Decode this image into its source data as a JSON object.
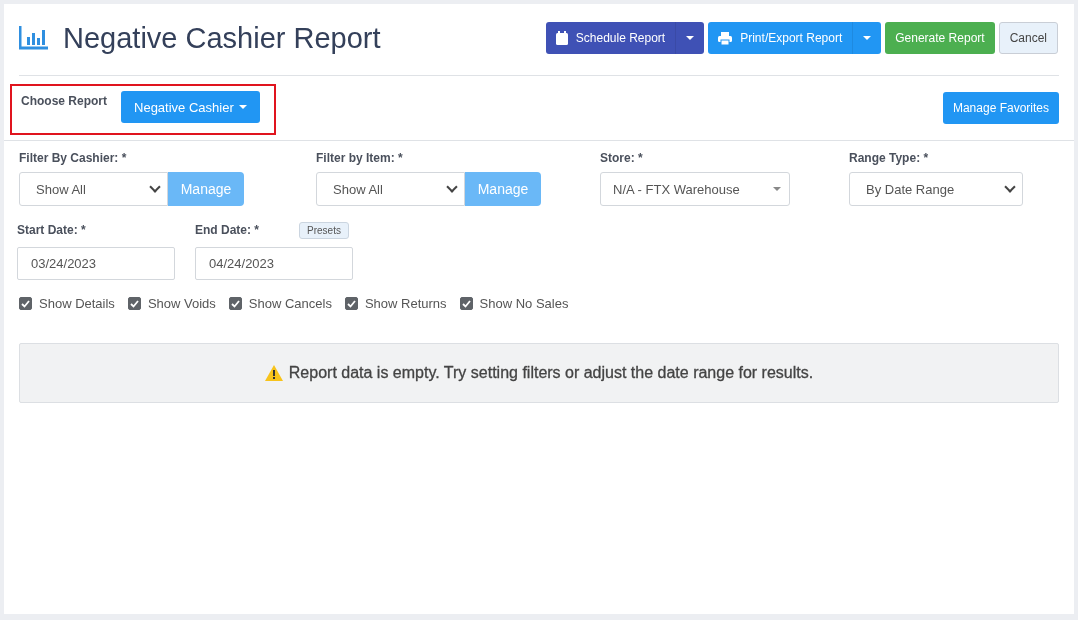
{
  "header": {
    "title": "Negative Cashier Report",
    "actions": [
      {
        "label": "Schedule Report",
        "kind": "schedule"
      },
      {
        "label": "Print/Export Report",
        "kind": "export"
      },
      {
        "label": "Generate Report",
        "kind": "generate"
      },
      {
        "label": "Cancel",
        "kind": "cancel"
      }
    ]
  },
  "choose_report": {
    "label": "Choose Report",
    "value": "Negative Cashier",
    "highlighted": true
  },
  "manage_favorites": "Manage Favorites",
  "filters": [
    {
      "label": "Filter By Cashier: *",
      "kind": "select-manage",
      "value": "Show All",
      "button": "Manage"
    },
    {
      "label": "Filter by Item: *",
      "kind": "select-manage",
      "value": "Show All",
      "button": "Manage"
    },
    {
      "label": "Store: *",
      "kind": "combo",
      "value": "N/A - FTX Warehouse"
    },
    {
      "label": "Range Type: *",
      "kind": "select",
      "value": "By Date Range"
    }
  ],
  "dates": [
    {
      "label": "Start Date: *",
      "value": "03/24/2023"
    },
    {
      "label": "End Date: *",
      "value": "04/24/2023",
      "presets": "Presets"
    }
  ],
  "options": [
    {
      "label": "Show Details",
      "checked": true
    },
    {
      "label": "Show Voids",
      "checked": true
    },
    {
      "label": "Show Cancels",
      "checked": true
    },
    {
      "label": "Show Returns",
      "checked": true
    },
    {
      "label": "Show No Sales",
      "checked": true
    }
  ],
  "alert": "Report data is empty. Try setting filters or adjust the date range for results."
}
